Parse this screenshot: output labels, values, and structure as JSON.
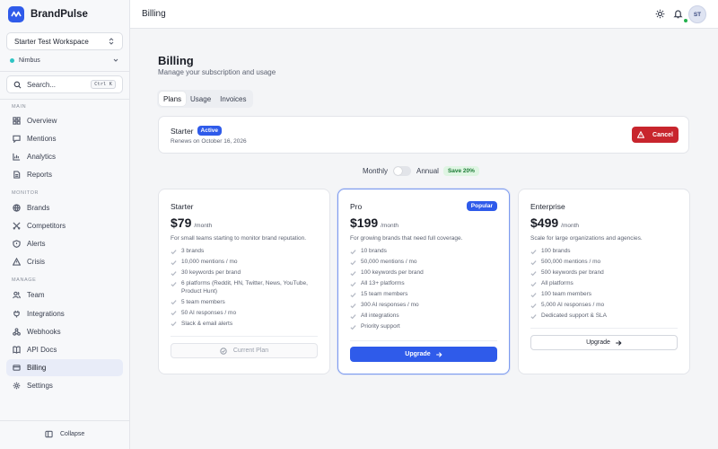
{
  "app": {
    "name": "BrandPulse"
  },
  "sidebar": {
    "workspace": "Starter Test Workspace",
    "project": "Nimbus",
    "search": {
      "placeholder": "Search...",
      "shortcut": "Ctrl K"
    },
    "sections": {
      "main": "MAIN",
      "monitor": "MONITOR",
      "manage": "MANAGE"
    },
    "items": [
      {
        "label": "Overview",
        "icon": "grid-icon"
      },
      {
        "label": "Mentions",
        "icon": "chat-icon"
      },
      {
        "label": "Analytics",
        "icon": "chart-icon"
      },
      {
        "label": "Reports",
        "icon": "document-icon"
      },
      {
        "label": "Brands",
        "icon": "globe-icon"
      },
      {
        "label": "Competitors",
        "icon": "swords-icon"
      },
      {
        "label": "Alerts",
        "icon": "shield-alert-icon"
      },
      {
        "label": "Crisis",
        "icon": "warning-icon"
      },
      {
        "label": "Team",
        "icon": "users-icon"
      },
      {
        "label": "Integrations",
        "icon": "plug-icon"
      },
      {
        "label": "Webhooks",
        "icon": "webhook-icon"
      },
      {
        "label": "API Docs",
        "icon": "book-icon"
      },
      {
        "label": "Billing",
        "icon": "credit-card-icon",
        "active": true
      },
      {
        "label": "Settings",
        "icon": "gear-icon"
      }
    ],
    "collapse": "Collapse"
  },
  "header": {
    "title": "Billing",
    "avatar_initials": "ST"
  },
  "main": {
    "title": "Billing",
    "subtitle": "Manage your subscription and usage",
    "tabs": [
      "Plans",
      "Usage",
      "Invoices"
    ],
    "current_plan": {
      "name": "Starter",
      "status": "Active",
      "renews": "Renews on October 16, 2026",
      "cancel_label": "Cancel"
    },
    "toggle": {
      "monthly": "Monthly",
      "annual": "Annual",
      "save": "Save 20%",
      "annual_selected": false
    },
    "plans": [
      {
        "name": "Starter",
        "price": "$79",
        "per": "/month",
        "desc": "For small teams starting to monitor brand reputation.",
        "features": [
          "3 brands",
          "10,000 mentions / mo",
          "30 keywords per brand",
          "6 platforms (Reddit, HN, Twitter, News, YouTube, Product Hunt)",
          "5 team members",
          "50 AI responses / mo",
          "Slack & email alerts"
        ],
        "button": "Current Plan"
      },
      {
        "name": "Pro",
        "badge": "Popular",
        "price": "$199",
        "per": "/month",
        "desc": "For growing brands that need full coverage.",
        "features": [
          "10 brands",
          "50,000 mentions / mo",
          "100 keywords per brand",
          "All 13+ platforms",
          "15 team members",
          "300 AI responses / mo",
          "All integrations",
          "Priority support"
        ],
        "button": "Upgrade"
      },
      {
        "name": "Enterprise",
        "price": "$499",
        "per": "/month",
        "desc": "Scale for large organizations and agencies.",
        "features": [
          "100 brands",
          "500,000 mentions / mo",
          "500 keywords per brand",
          "All platforms",
          "100 team members",
          "5,000 AI responses / mo",
          "Dedicated support & SLA"
        ],
        "button": "Upgrade"
      }
    ]
  },
  "colors": {
    "accent": "#2f5bea",
    "danger": "#c8252d",
    "success": "#22b14c"
  }
}
